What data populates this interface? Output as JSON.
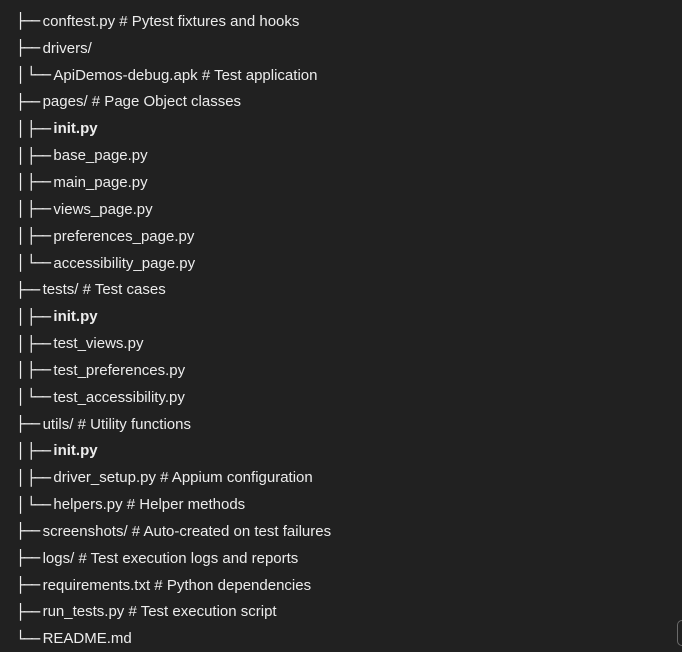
{
  "tree": {
    "lines": [
      {
        "prefix": "├──",
        "text": "conftest.py # Pytest fixtures and hooks",
        "bold": false
      },
      {
        "prefix": "├──",
        "text": "drivers/",
        "bold": false
      },
      {
        "prefix": "│  └──",
        "text": "ApiDemos-debug.apk # Test application",
        "bold": false
      },
      {
        "prefix": "├──",
        "text": "pages/ # Page Object classes",
        "bold": false
      },
      {
        "prefix": "│  ├──",
        "text": "init.py",
        "bold": true
      },
      {
        "prefix": "│  ├──",
        "text": "base_page.py",
        "bold": false
      },
      {
        "prefix": "│  ├──",
        "text": "main_page.py",
        "bold": false
      },
      {
        "prefix": "│  ├──",
        "text": "views_page.py",
        "bold": false
      },
      {
        "prefix": "│  ├──",
        "text": "preferences_page.py",
        "bold": false
      },
      {
        "prefix": "│  └──",
        "text": "accessibility_page.py",
        "bold": false
      },
      {
        "prefix": "├──",
        "text": "tests/ # Test cases",
        "bold": false
      },
      {
        "prefix": "│  ├──",
        "text": "init.py",
        "bold": true
      },
      {
        "prefix": "│  ├──",
        "text": "test_views.py",
        "bold": false
      },
      {
        "prefix": "│  ├──",
        "text": "test_preferences.py",
        "bold": false
      },
      {
        "prefix": "│  └──",
        "text": "test_accessibility.py",
        "bold": false
      },
      {
        "prefix": "├──",
        "text": "utils/ # Utility functions",
        "bold": false
      },
      {
        "prefix": "│  ├──",
        "text": "init.py",
        "bold": true
      },
      {
        "prefix": "│  ├──",
        "text": "driver_setup.py # Appium configuration",
        "bold": false
      },
      {
        "prefix": "│  └──",
        "text": "helpers.py # Helper methods",
        "bold": false
      },
      {
        "prefix": "├──",
        "text": "screenshots/ # Auto-created on test failures",
        "bold": false
      },
      {
        "prefix": "├──",
        "text": "logs/ # Test execution logs and reports",
        "bold": false
      },
      {
        "prefix": "├──",
        "text": "requirements.txt # Python dependencies",
        "bold": false
      },
      {
        "prefix": "├──",
        "text": "run_tests.py # Test execution script",
        "bold": false
      },
      {
        "prefix": "└──",
        "text": "README.md",
        "bold": false
      }
    ]
  }
}
